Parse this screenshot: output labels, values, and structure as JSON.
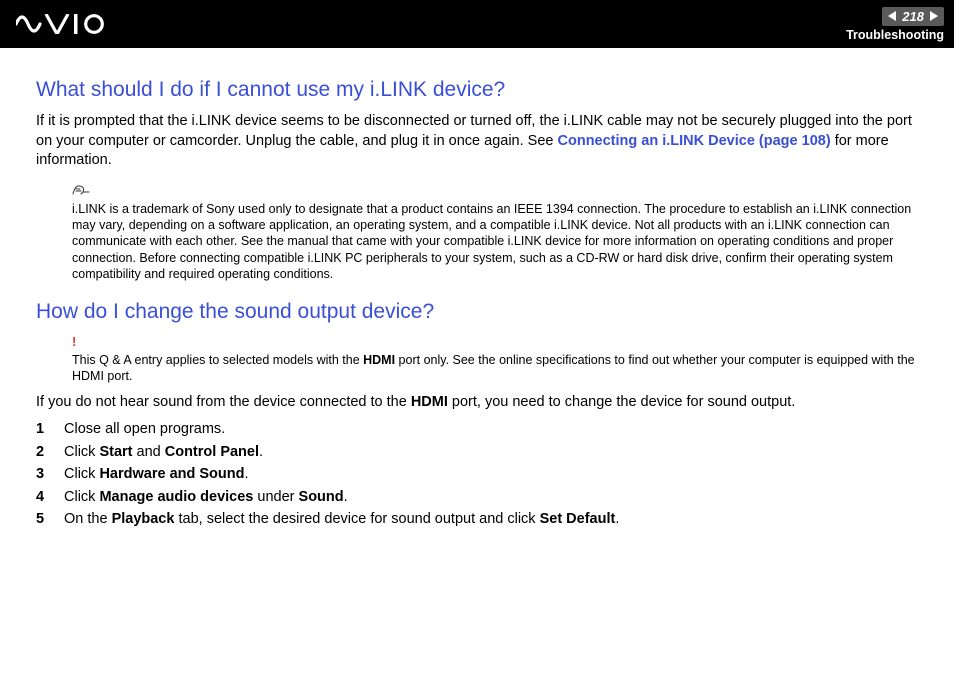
{
  "header": {
    "page_number": "218",
    "section": "Troubleshooting"
  },
  "q1": {
    "title": "What should I do if I cannot use my i.LINK device?",
    "body_pre": "If it is prompted that the i.LINK device seems to be disconnected or turned off, the i.LINK cable may not be securely plugged into the port on your computer or camcorder. Unplug the cable, and plug it in once again. See ",
    "link_text": "Connecting an i.LINK Device (page 108)",
    "body_post": " for more information.",
    "note": "i.LINK is a trademark of Sony used only to designate that a product contains an IEEE 1394 connection. The procedure to establish an i.LINK connection may vary, depending on a software application, an operating system, and a compatible i.LINK device. Not all products with an i.LINK connection can communicate with each other. See the manual that came with your compatible i.LINK device for more information on operating conditions and proper connection. Before connecting compatible i.LINK PC peripherals to your system, such as a CD-RW or hard disk drive, confirm their operating system compatibility and required operating conditions."
  },
  "q2": {
    "title": "How do I change the sound output device?",
    "warn_pre": "This Q & A entry applies to selected models with the ",
    "warn_bold": "HDMI",
    "warn_post": " port only. See the online specifications to find out whether your computer is equipped with the HDMI port.",
    "body_pre": "If you do not hear sound from the device connected to the ",
    "body_bold": "HDMI",
    "body_post": " port, you need to change the device for sound output.",
    "steps": [
      {
        "n": "1",
        "pre": "Close all open programs.",
        "b1": "",
        "mid": "",
        "b2": "",
        "post": ""
      },
      {
        "n": "2",
        "pre": "Click ",
        "b1": "Start",
        "mid": " and ",
        "b2": "Control Panel",
        "post": "."
      },
      {
        "n": "3",
        "pre": "Click ",
        "b1": "Hardware and Sound",
        "mid": "",
        "b2": "",
        "post": "."
      },
      {
        "n": "4",
        "pre": "Click ",
        "b1": "Manage audio devices",
        "mid": " under ",
        "b2": "Sound",
        "post": "."
      },
      {
        "n": "5",
        "pre": "On the ",
        "b1": "Playback",
        "mid": " tab, select the desired device for sound output and click ",
        "b2": "Set Default",
        "post": "."
      }
    ]
  }
}
